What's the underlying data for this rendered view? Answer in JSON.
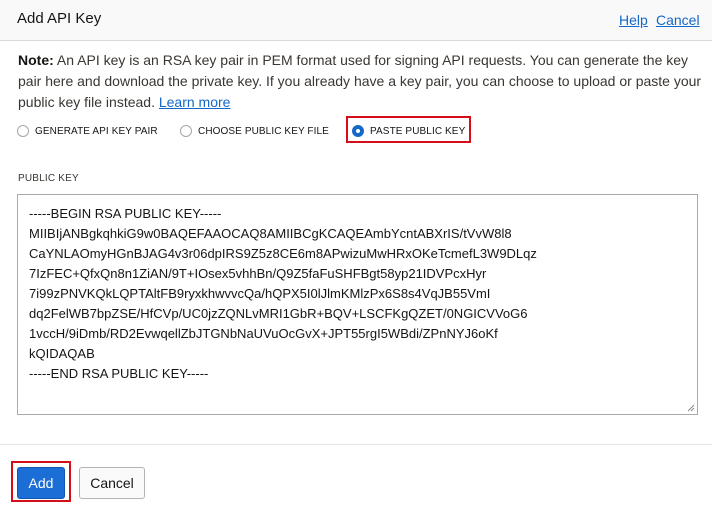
{
  "header": {
    "title": "Add API Key",
    "help_link": "Help",
    "cancel_link": "Cancel"
  },
  "note": {
    "label": "Note:",
    "text": " An API key is an RSA key pair in PEM format used for signing API requests. You can generate the key pair here and download the private key. If you already have a key pair, you can choose to upload or paste your public key file instead. ",
    "learn_more": "Learn more"
  },
  "key_options": [
    {
      "label": "GENERATE API KEY PAIR",
      "selected": false
    },
    {
      "label": "CHOOSE PUBLIC KEY FILE",
      "selected": false
    },
    {
      "label": "PASTE PUBLIC KEY",
      "selected": true
    }
  ],
  "public_key": {
    "label": "PUBLIC KEY",
    "lines": [
      "-----BEGIN RSA PUBLIC KEY-----",
      "MIIBIjANBgkqhkiG9w0BAQEFAAOCAQ8AMIIBCgKCAQEAmbYcntABXrIS/tVvW8l8",
      "CaYNLAOmyHGnBJAG4v3r06dpIRS9Z5z8CE6m8APwizuMwHRxOKeTcmefL3W9DLqz",
      "7IzFEC+QfxQn8n1ZiAN/9T+IOsex5vhhBn/Q9Z5faFuSHFBgt58yp21IDVPcxHyr",
      "7i99zPNVKQkLQPTAltFB9ryxkhwvvcQa/hQPX5I0lJlmKMlzPx6S8s4VqJB55VmI",
      "dq2FelWB7bpZSE/HfCVp/UC0jzZQNLvMRI1GbR+BQV+LSCFKgQZET/0NGICVVoG6",
      "1vccH/9iDmb/RD2EvwqellZbJTGNbNaUVuOcGvX+JPT55rgI5WBdi/ZPnNYJ6oKf",
      "kQIDAQAB",
      "-----END RSA PUBLIC KEY-----"
    ]
  },
  "footer": {
    "add_label": "Add",
    "cancel_label": "Cancel"
  },
  "colors": {
    "accent": "#1b6ed6",
    "link": "#1468c8",
    "highlight": "#d40f1a"
  }
}
